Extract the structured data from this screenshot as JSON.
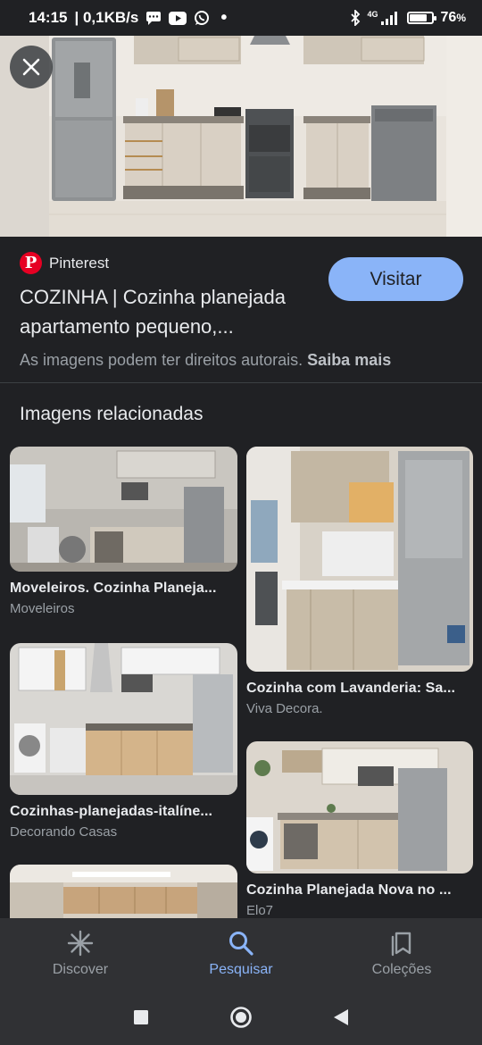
{
  "status_bar": {
    "time": "14:15",
    "speed": "| 0,1KB/s",
    "network": "4G",
    "battery": "76",
    "battery_unit": "%",
    "battery_level": 0.76
  },
  "hero": {
    "close_icon": "close-icon"
  },
  "source": {
    "name": "Pinterest",
    "title": "COZINHA | Cozinha planejada apartamento pequeno,...",
    "visit_label": "Visitar",
    "copyright_text": "As imagens podem ter direitos autorais.",
    "learn_more": "Saiba mais"
  },
  "related": {
    "heading": "Imagens relacionadas",
    "items": [
      {
        "title": "Moveleiros. Cozinha Planeja...",
        "source": "Moveleiros"
      },
      {
        "title": "Cozinha com Lavanderia: Sa...",
        "source": "Viva Decora."
      },
      {
        "title": "Cozinhas-planejadas-italíne...",
        "source": "Decorando Casas"
      },
      {
        "title": "Cozinha Planejada Nova no ...",
        "source": "Elo7"
      }
    ]
  },
  "bottom_nav": {
    "items": [
      {
        "label": "Discover",
        "icon": "asterisk-icon"
      },
      {
        "label": "Pesquisar",
        "icon": "search-icon",
        "active": true
      },
      {
        "label": "Coleções",
        "icon": "collections-icon"
      }
    ]
  },
  "colors": {
    "background": "#202124",
    "accent": "#8ab4f8",
    "pinterest": "#e60023",
    "nav_background": "#303134"
  }
}
